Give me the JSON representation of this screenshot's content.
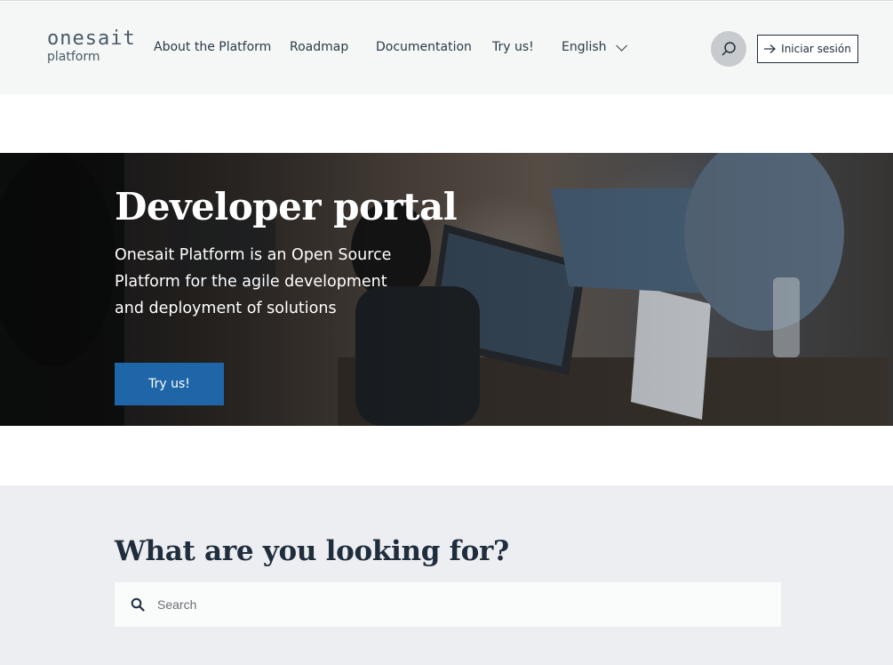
{
  "header": {
    "logo_main": "onesait",
    "logo_sub": "platform",
    "nav": {
      "about": "About the Platform",
      "roadmap": "Roadmap",
      "documentation": "Documentation",
      "try": "Try us!",
      "language": "English"
    },
    "search_icon": "search-icon",
    "login_label": "Iniciar sesión",
    "login_icon": "arrow-right-icon"
  },
  "hero": {
    "title": "Developer portal",
    "subtitle": "Onesait Platform is an Open Source Platform for the agile development and deployment of solutions",
    "cta_label": "Try us!",
    "cta_color": "#1e66a8"
  },
  "search_section": {
    "heading": "What are you looking for?",
    "placeholder": "Search",
    "icon": "search-icon"
  }
}
